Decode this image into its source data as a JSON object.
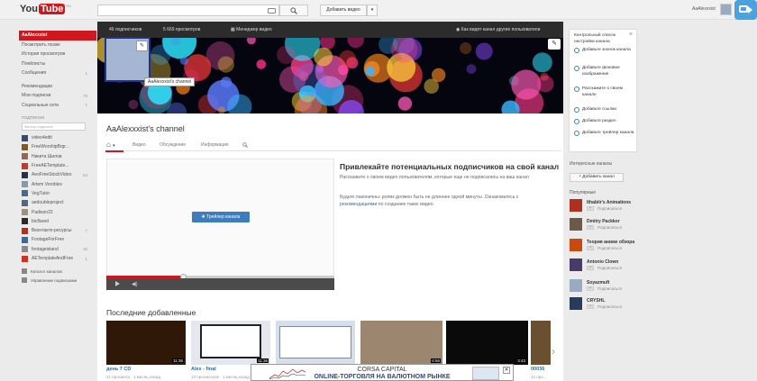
{
  "header": {
    "logo_text": "You",
    "logo_tube": "Tube",
    "logo_region": "RU",
    "search_placeholder": "",
    "upload_label": "Добавить видео",
    "upload_arrow": "▾",
    "username": "AaAlexxxist"
  },
  "sidebar": {
    "items": [
      {
        "label": "AaAlexxxist",
        "active": true,
        "count": ""
      },
      {
        "label": "Посмотреть позже",
        "count": ""
      },
      {
        "label": "История просмотров",
        "count": ""
      },
      {
        "label": "Плейлисты",
        "count": ""
      },
      {
        "label": "Сообщения",
        "count": "1"
      }
    ],
    "items2": [
      {
        "label": "Рекомендации",
        "count": ""
      },
      {
        "label": "Мои подписки",
        "count": "79"
      },
      {
        "label": "Социальные сети",
        "count": "1"
      }
    ],
    "subscriptions_heading": "ПОДПИСКИ",
    "subscriptions_filter_placeholder": "Фильтр подписок",
    "subscriptions": [
      {
        "label": "video4edit",
        "count": "",
        "color": "#3a4a6a"
      },
      {
        "label": "FreeWorshipBrgr...",
        "count": "",
        "color": "#7a5a2a"
      },
      {
        "label": "Никита Шилов",
        "count": "",
        "color": "#8a6a5a"
      },
      {
        "label": "FreeAETemplate...",
        "count": "",
        "color": "#c23b2a"
      },
      {
        "label": "AeoFreeStockVideo",
        "count": "53",
        "color": "#223344"
      },
      {
        "label": "Artem Vorobiev",
        "count": "",
        "color": "#8899aa"
      },
      {
        "label": "VegTutor",
        "count": "",
        "color": "#4a6a8a"
      },
      {
        "label": "aedoubleproject",
        "count": "",
        "color": "#556677"
      },
      {
        "label": "Padison22",
        "count": "",
        "color": "#a09080"
      },
      {
        "label": "bicflared",
        "count": "",
        "color": "#2a2a2a"
      },
      {
        "label": "Вконтакте-ресурсы",
        "count": "7",
        "color": "#b03020"
      },
      {
        "label": "FootageForFree",
        "count": "",
        "color": "#3a6a9a"
      },
      {
        "label": "footageisland",
        "count": "16",
        "color": "#8a8a8a"
      },
      {
        "label": "AETemplateAndFree",
        "count": "1",
        "color": "#cc3322"
      }
    ],
    "footer": [
      {
        "label": "Каталог каналов"
      },
      {
        "label": "Управление подписками"
      }
    ]
  },
  "channel": {
    "stats": {
      "subscribers": "46 подписчиков",
      "views": "5 669 просмотров",
      "video_manager": "Менеджер видео",
      "view_as": "Как видят канал другие пользователи"
    },
    "avatar_tooltip": "AaAlexxxist's channel",
    "title": "AaAlexxxist's channel",
    "tabs": [
      {
        "label": "Видео"
      },
      {
        "label": "Обсуждение"
      },
      {
        "label": "Информация"
      }
    ],
    "trailer_button": "Трейлер канала",
    "promo": {
      "title": "Привлекайте потенциальных подписчиков на свой канал",
      "text1": "Расскажите о своем видео пользователям, которые еще не подписались на ваш канал",
      "text2_before": "Будьте лаконичны: ролик должен быть не длиннее одной минуты. Ознакомьтесь с ",
      "text2_link": "рекомендациями",
      "text2_after": " по созданию таких видео."
    },
    "recent_heading": "Последние добавленные",
    "videos": [
      {
        "title": "день 7 CD",
        "meta": "21 просмотр · 1 месяц назад",
        "duration": "11:36",
        "color": "#301808"
      },
      {
        "title": "Alex - final",
        "meta": "13 просмотров · 1 месяц назад",
        "duration": "11:36",
        "color": "#e4e8ee"
      },
      {
        "title": "",
        "meta": "",
        "duration": "",
        "color": "#d8dfea"
      },
      {
        "title": "",
        "meta": "",
        "duration": "6:56",
        "color": "#9c8670"
      },
      {
        "title": "",
        "meta": "",
        "duration": "3:43",
        "color": "#0a0a0a"
      },
      {
        "title": "00036",
        "meta": "12 про...",
        "duration": "",
        "color": "#6a5030"
      }
    ]
  },
  "ad": {
    "line1": "CORSA CAPITAL",
    "line2": "ONLINE-ТОРГОВЛЯ НА ВАЛЮТНОМ РЫНКЕ",
    "close": "✕"
  },
  "checklist": {
    "heading": "Контрольный список настройки канала",
    "close": "×",
    "items": [
      {
        "label": "Добавьте значок канала"
      },
      {
        "label": "Добавьте фоновое изображение"
      },
      {
        "label": "Расскажите о своем канале"
      },
      {
        "label": "Добавьте ссылки"
      },
      {
        "label": "Добавьте раздел"
      },
      {
        "label": "Добавьте трейлер канала"
      }
    ]
  },
  "right": {
    "interesting_label": "Интересные каналы",
    "add_channel": "+ Добавить канал",
    "popular_label": "Популярные",
    "subscribe_label": "Подписаться",
    "popular": [
      {
        "name": "Ithabiir's Animations",
        "color": "#b03020"
      },
      {
        "name": "Dmitry Packkor",
        "color": "#6a5a4a"
      },
      {
        "name": "Теория аниме обзора",
        "color": "#c84a10"
      },
      {
        "name": "Antonio Clown",
        "color": "#4a3a6a"
      },
      {
        "name": "Soyazmuft",
        "color": "#9aaac0"
      },
      {
        "name": "CRYSHL",
        "color": "#2a3a5a"
      }
    ]
  }
}
